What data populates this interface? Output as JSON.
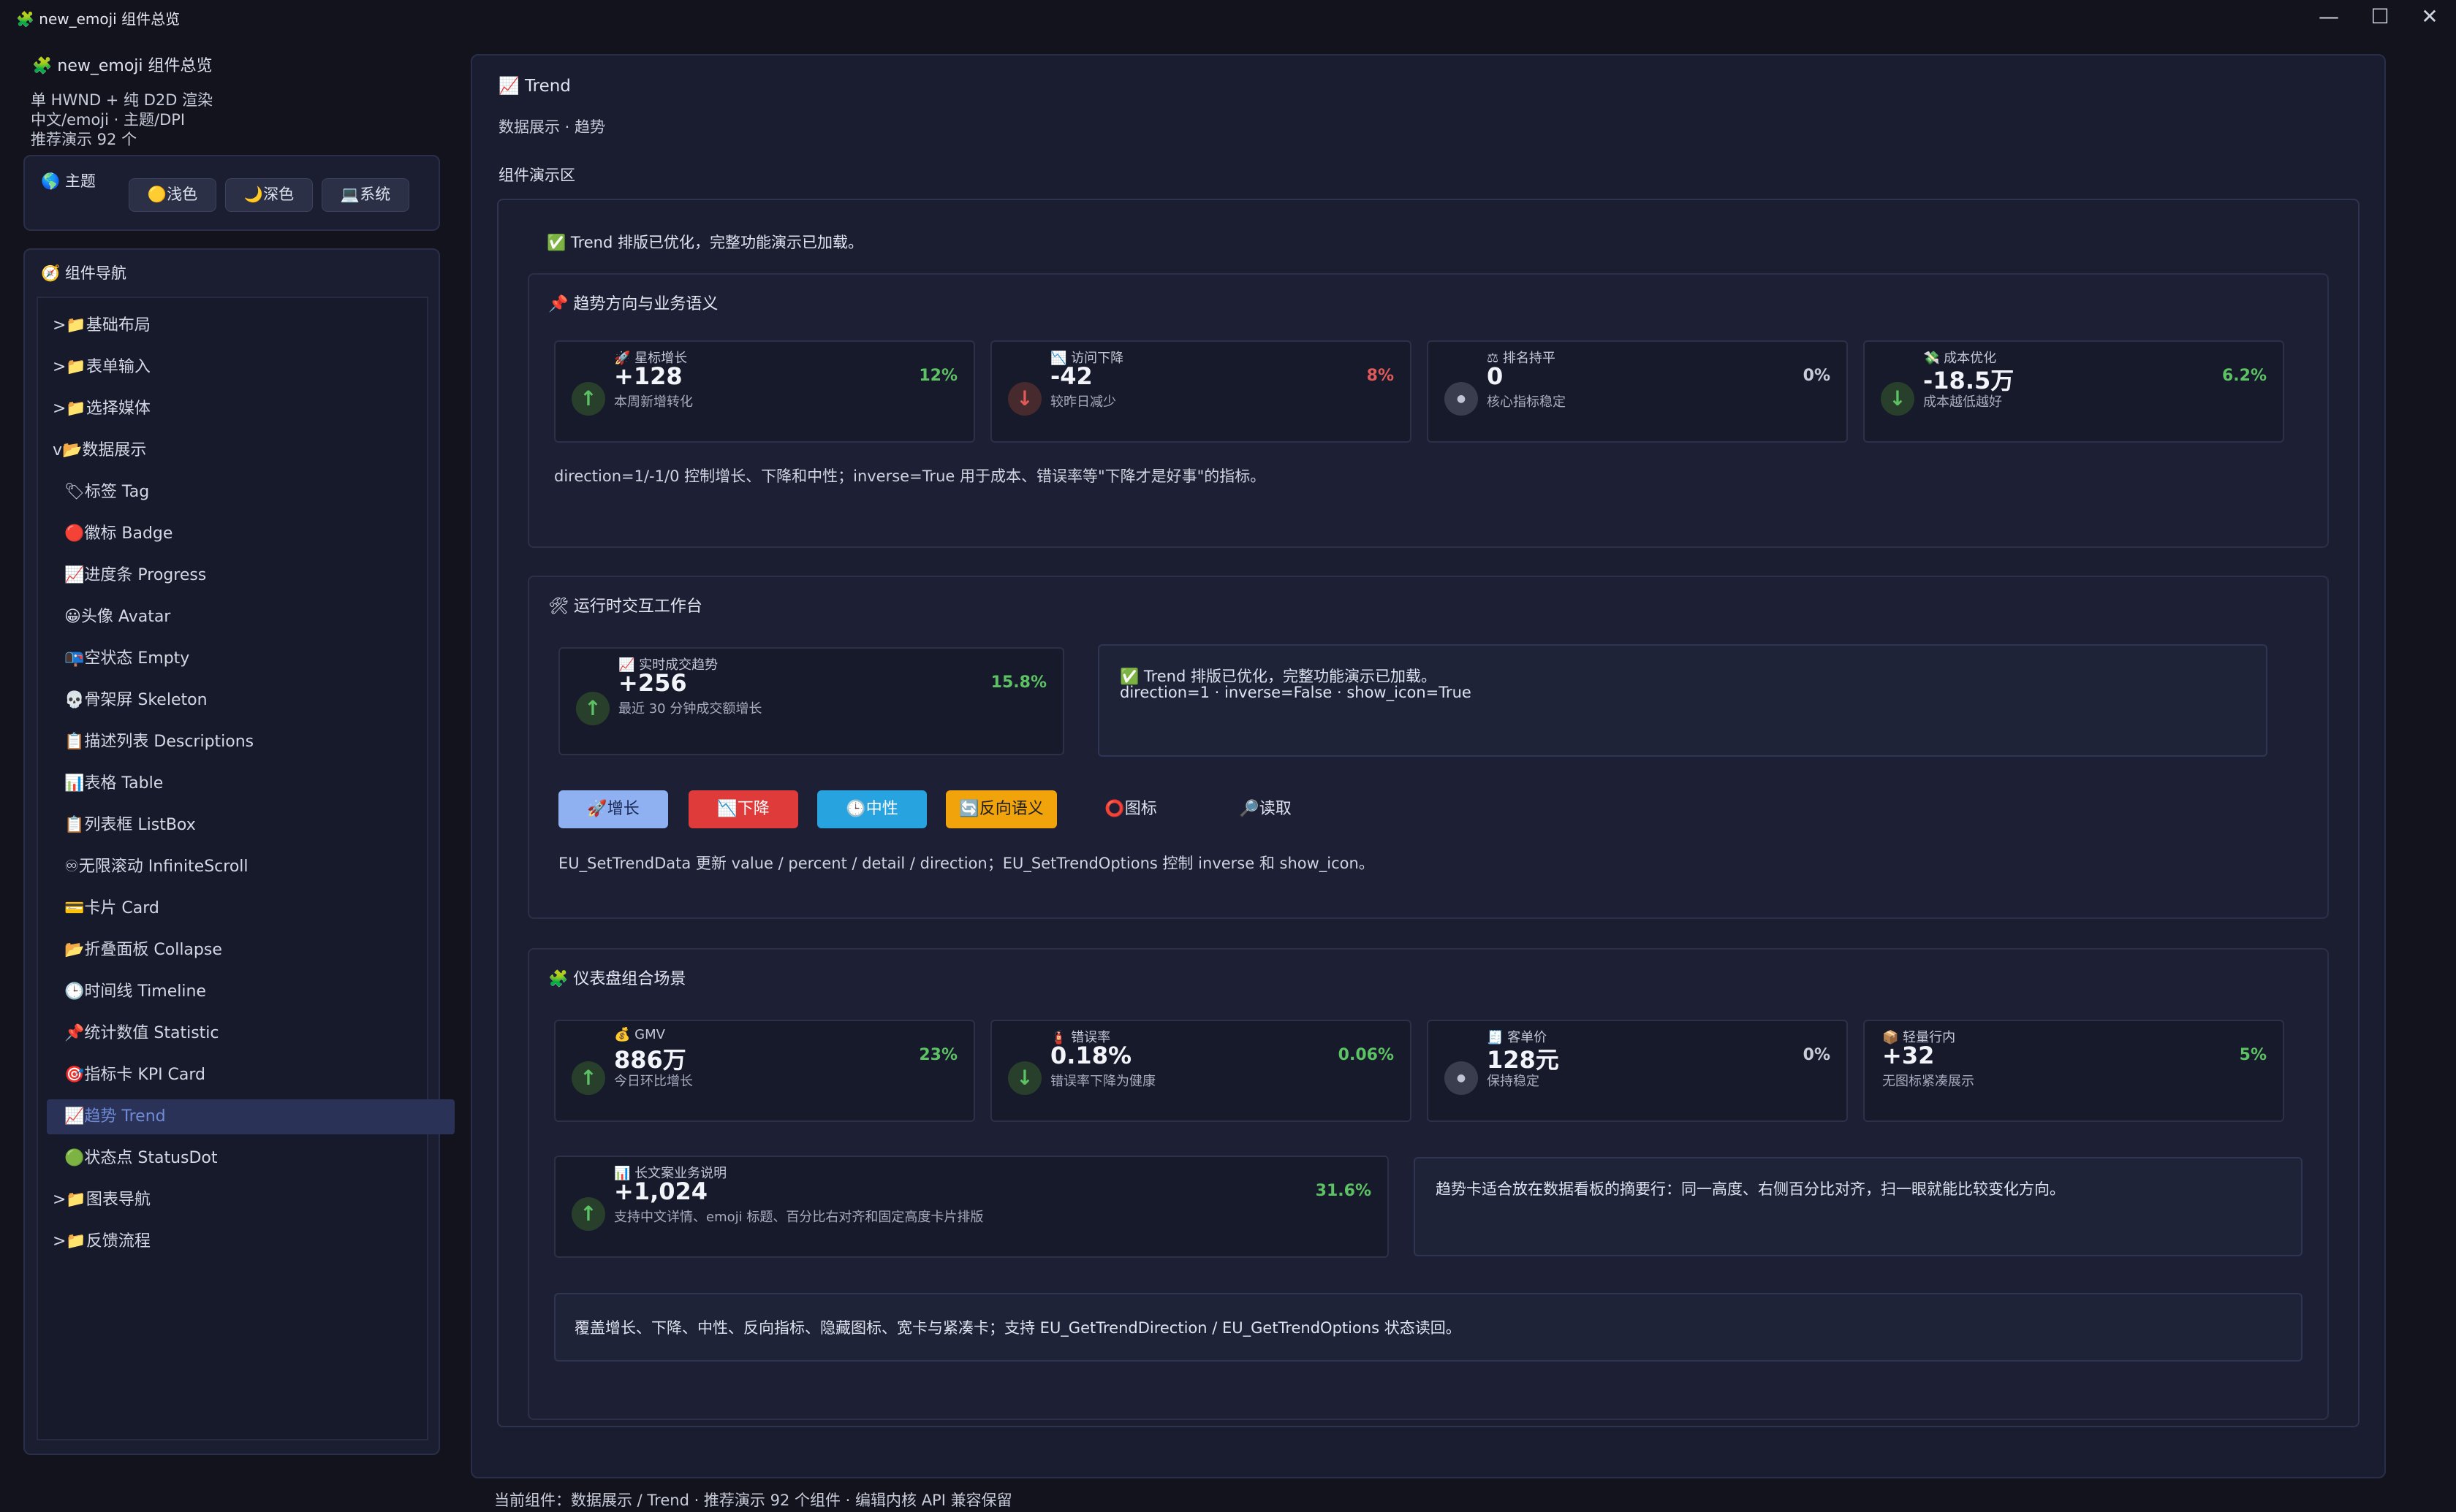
{
  "window": {
    "title_icon": "🧩",
    "title": "new_emoji 组件总览",
    "controls": {
      "minimize": "—",
      "maximize": "☐",
      "close": "✕"
    }
  },
  "sidebar": {
    "app_icon": "🧩",
    "app_title": "new_emoji 组件总览",
    "info_lines": [
      "单 HWND + 纯 D2D 渲染",
      "中文/emoji · 主题/DPI",
      "推荐演示 92 个"
    ],
    "theme": {
      "icon": "🌎",
      "title": "主题",
      "buttons": [
        {
          "icon": "🟡",
          "label": "浅色"
        },
        {
          "icon": "🌙",
          "label": "深色"
        },
        {
          "icon": "💻",
          "label": "系统"
        }
      ]
    },
    "nav": {
      "icon": "🧭",
      "title": "组件导航",
      "items": [
        {
          "text": ">📁基础布局"
        },
        {
          "text": ">📁表单输入"
        },
        {
          "text": ">📁选择媒体"
        },
        {
          "text": "v📂数据展示"
        },
        {
          "text": "🏷标签 Tag"
        },
        {
          "text": "🔴徽标 Badge"
        },
        {
          "text": "📈进度条 Progress"
        },
        {
          "text": "😀头像 Avatar"
        },
        {
          "text": "📭空状态 Empty"
        },
        {
          "text": "💀骨架屏 Skeleton"
        },
        {
          "text": "📋描述列表 Descriptions"
        },
        {
          "text": "📊表格 Table"
        },
        {
          "text": "📋列表框 ListBox"
        },
        {
          "text": "♾无限滚动 InfiniteScroll"
        },
        {
          "text": "💳卡片 Card"
        },
        {
          "text": "📂折叠面板 Collapse"
        },
        {
          "text": "🕒时间线 Timeline"
        },
        {
          "text": "📌统计数值 Statistic"
        },
        {
          "text": "🎯指标卡 KPI Card"
        },
        {
          "text": "📈趋势 Trend"
        },
        {
          "text": "🟢状态点 StatusDot"
        },
        {
          "text": ">📁图表导航"
        },
        {
          "text": ">📁反馈流程"
        }
      ],
      "selected_index": 19
    }
  },
  "main": {
    "header_icon": "📈",
    "header_title": "Trend",
    "subtitle": "数据展示 · 趋势",
    "demo_label": "组件演示区",
    "status_banner": "✅ Trend 排版已优化，完整功能演示已加载。",
    "section1": {
      "title": "📌 趋势方向与业务语义",
      "cards": [
        {
          "label": "🚀 星标增长",
          "value": "+128",
          "detail": "本周新增转化",
          "percent": "12%",
          "direction": "up"
        },
        {
          "label": "📉 访问下降",
          "value": "-42",
          "detail": "较昨日减少",
          "percent": "8%",
          "direction": "down"
        },
        {
          "label": "⚖ 排名持平",
          "value": "0",
          "detail": "核心指标稳定",
          "percent": "0%",
          "direction": "flat"
        },
        {
          "label": "💸 成本优化",
          "value": "-18.5万",
          "detail": "成本越低越好",
          "percent": "6.2%",
          "direction": "down-good"
        }
      ],
      "note": "direction=1/-1/0 控制增长、下降和中性；inverse=True 用于成本、错误率等\"下降才是好事\"的指标。"
    },
    "section2": {
      "title": "🛠 运行时交互工作台",
      "card": {
        "label": "📈 实时成交趋势",
        "value": "+256",
        "detail": "最近 30 分钟成交额增长",
        "percent": "15.8%",
        "direction": "up"
      },
      "info_line1": "✅ Trend 排版已优化，完整功能演示已加载。",
      "info_line2": "direction=1 · inverse=False · show_icon=True",
      "buttons": [
        {
          "label": "🚀增长",
          "bg": "#8fb1f2",
          "color": "#1b2a55"
        },
        {
          "label": "📉下降",
          "bg": "#e03b3b",
          "color": "#ffffff"
        },
        {
          "label": "🕒中性",
          "bg": "#27a3e0",
          "color": "#ffffff"
        },
        {
          "label": "🔄反向语义",
          "bg": "#f0a30a",
          "color": "#1e1e1e"
        },
        {
          "label": "⭕图标",
          "bg": "transparent",
          "color": "#dfe3ef"
        },
        {
          "label": "🔎读取",
          "bg": "transparent",
          "color": "#dfe3ef"
        }
      ],
      "note": "EU_SetTrendData 更新 value / percent / detail / direction；EU_SetTrendOptions 控制 inverse 和 show_icon。"
    },
    "section3": {
      "title": "🧩 仪表盘组合场景",
      "cards": [
        {
          "label": "💰 GMV",
          "value": "886万",
          "detail": "今日环比增长",
          "percent": "23%",
          "direction": "up"
        },
        {
          "label": "🧯 错误率",
          "value": "0.18%",
          "detail": "错误率下降为健康",
          "percent": "0.06%",
          "direction": "down-good"
        },
        {
          "label": "🧾 客单价",
          "value": "128元",
          "detail": "保持稳定",
          "percent": "0%",
          "direction": "flat"
        },
        {
          "label": "📦 轻量行内",
          "value": "+32",
          "detail": "无图标紧凑展示",
          "percent": "5%",
          "direction": "none"
        }
      ],
      "wide_card": {
        "label": "📊 长文案业务说明",
        "value": "+1,024",
        "detail": "支持中文详情、emoji 标题、百分比右对齐和固定高度卡片排版",
        "percent": "31.6%",
        "direction": "up"
      },
      "side_text": "趋势卡适合放在数据看板的摘要行：同一高度、右侧百分比对齐，扫一眼就能比较变化方向。",
      "summary": "覆盖增长、下降、中性、反向指标、隐藏图标、宽卡与紧凑卡；支持 EU_GetTrendDirection / EU_GetTrendOptions 状态读回。"
    }
  },
  "status_bar": "当前组件：数据展示 / Trend · 推荐演示 92 个组件 · 编辑内核 API 兼容保留",
  "colors": {
    "up": "#5cc264",
    "down": "#e05a5a",
    "accent": "#6f8bd6",
    "panel": "#1b1e30"
  },
  "icons": {
    "up": "arrow-up-icon",
    "down": "arrow-down-icon",
    "flat": "dot-icon"
  }
}
